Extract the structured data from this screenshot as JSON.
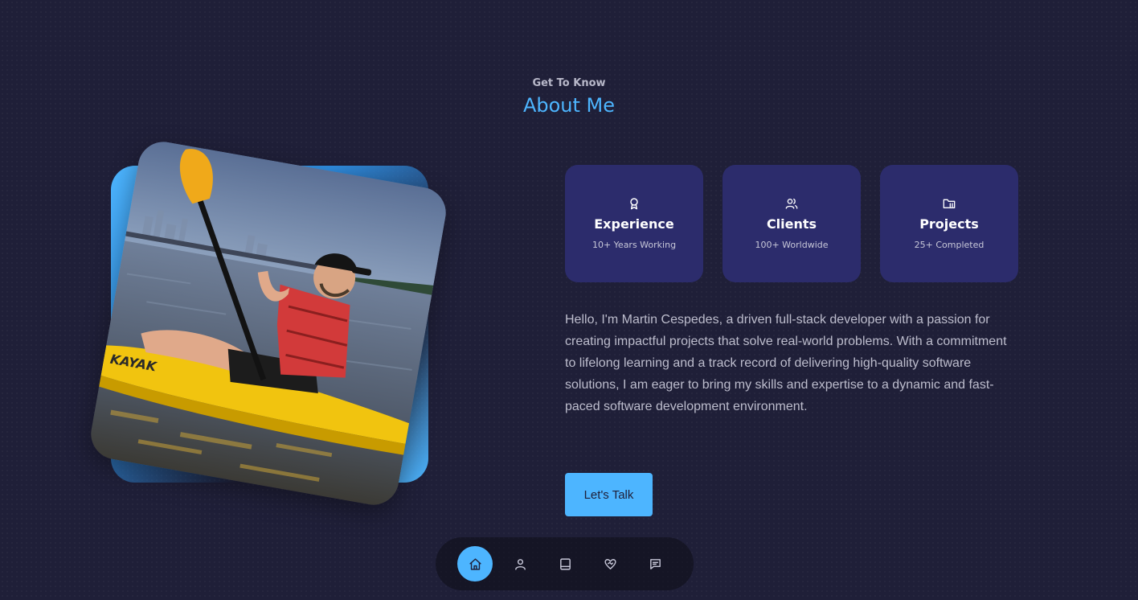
{
  "header": {
    "eyebrow": "Get To Know",
    "title": "About Me"
  },
  "photo": {
    "text_on_kayak": "KAYAK"
  },
  "cards": [
    {
      "icon": "award-icon",
      "title": "Experience",
      "subtitle": "10+ Years Working"
    },
    {
      "icon": "users-icon",
      "title": "Clients",
      "subtitle": "100+ Worldwide"
    },
    {
      "icon": "folder-icon",
      "title": "Projects",
      "subtitle": "25+ Completed"
    }
  ],
  "bio": "Hello, I'm Martin Cespedes, a driven full-stack developer with a passion for creating impactful projects that solve real-world problems. With a commitment to lifelong learning and a track record of delivering high-quality software solutions, I am eager to bring my skills and expertise to a dynamic and fast-paced software development environment.",
  "cta": {
    "label": "Let's Talk"
  },
  "nav": {
    "items": [
      {
        "icon": "home-icon",
        "active": true
      },
      {
        "icon": "user-icon",
        "active": false
      },
      {
        "icon": "book-icon",
        "active": false
      },
      {
        "icon": "heart-handshake-icon",
        "active": false
      },
      {
        "icon": "message-icon",
        "active": false
      }
    ]
  },
  "colors": {
    "background": "#1f1f38",
    "accent": "#4db5ff",
    "card": "#2c2c6c",
    "text_muted": "#bdbdcd"
  }
}
